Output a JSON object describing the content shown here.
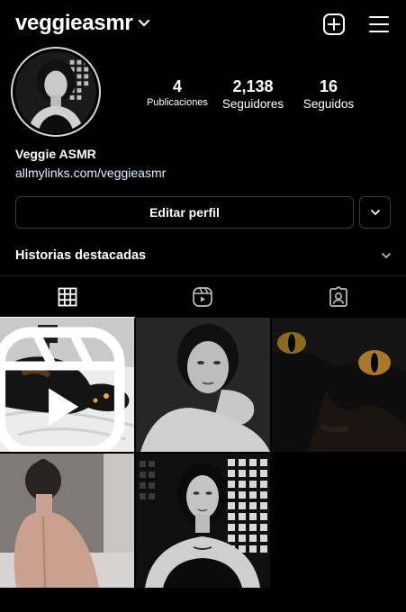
{
  "header": {
    "username": "veggieasmr",
    "icons": [
      "chevron-down-icon",
      "new-post-icon",
      "hamburger-menu-icon"
    ]
  },
  "profile": {
    "display_name": "Veggie ASMR",
    "link": "allmylinks.com/veggieasmr",
    "stats": {
      "posts": {
        "value": "4",
        "label": "Publicaciones"
      },
      "followers": {
        "value": "2,138",
        "label": "Seguidores"
      },
      "following": {
        "value": "16",
        "label": "Seguidos"
      }
    }
  },
  "actions": {
    "edit_profile": "Editar perfil"
  },
  "highlights": {
    "title": "Historias destacadas"
  },
  "tabs": [
    {
      "icon": "grid-icon",
      "active": true
    },
    {
      "icon": "reels-icon",
      "active": false
    },
    {
      "icon": "tagged-icon",
      "active": false
    }
  ],
  "posts": [
    {
      "subject": "cat on bed",
      "type": "reel"
    },
    {
      "subject": "portrait black and white",
      "type": "photo"
    },
    {
      "subject": "black cat close-up",
      "type": "photo"
    },
    {
      "subject": "back portrait",
      "type": "photo"
    },
    {
      "subject": "portrait with lights",
      "type": "photo"
    }
  ],
  "colors": {
    "background": "#000000",
    "text": "#ffffff",
    "link": "#e0f1ff",
    "border": "#3a3a3a"
  }
}
